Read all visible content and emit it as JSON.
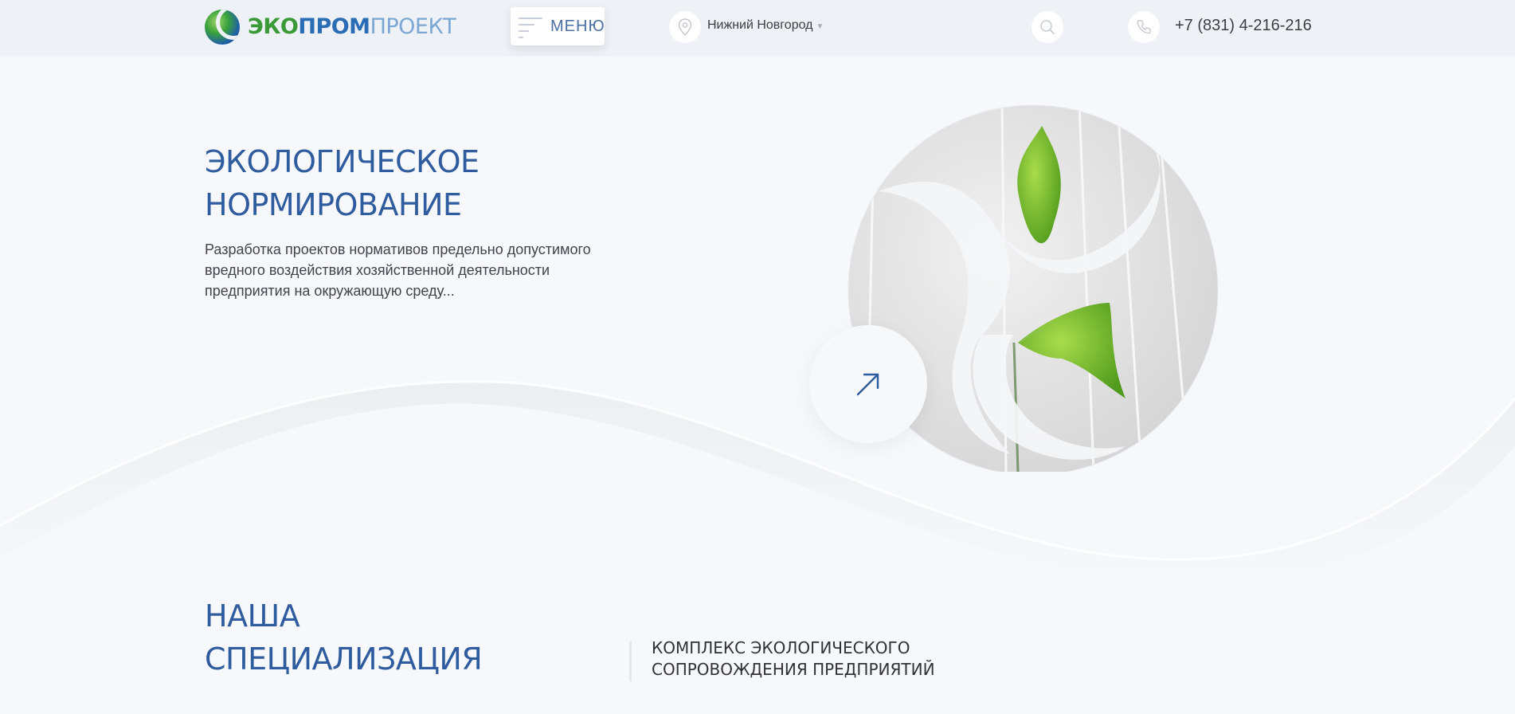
{
  "header": {
    "logo": {
      "part1": "ЭКО",
      "part2": "ПРОМ",
      "part3": "ПРОЕКТ"
    },
    "menu_label": "МЕНЮ",
    "city": "Нижний Новгород",
    "phone": "+7 (831) 4-216-216"
  },
  "hero": {
    "title_line1": "ЭКОЛОГИЧЕСКОЕ",
    "title_line2": "НОРМИРОВАНИЕ",
    "description": "Разработка проектов нормативов предельно допустимого вредного воздействия хозяйственной деятельности предприятия на окружающую среду..."
  },
  "specialization": {
    "title_line1": "НАША",
    "title_line2": "СПЕЦИАЛИЗАЦИЯ",
    "subtitle_line1": "КОМПЛЕКС ЭКОЛОГИЧЕСКОГО",
    "subtitle_line2": "СОПРОВОЖДЕНИЯ ПРЕДПРИЯТИЙ"
  },
  "icons": {
    "menu": "hamburger-icon",
    "city": "map-pin-icon",
    "search": "search-icon",
    "phone": "phone-icon",
    "arrow": "arrow-up-right-icon"
  },
  "colors": {
    "brand_blue": "#2f5c9e",
    "brand_green": "#3a9a38",
    "background": "#f6f8fb",
    "header_background": "#eef1f5"
  }
}
